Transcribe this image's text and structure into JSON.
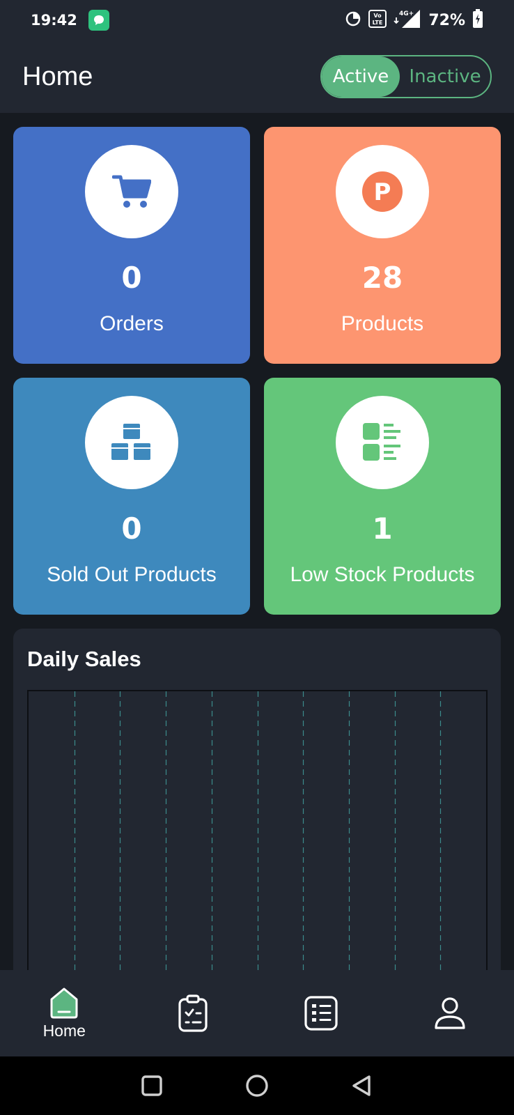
{
  "status_bar": {
    "time": "19:42",
    "network": "4G+",
    "volte": "Vo LTE",
    "battery": "72%"
  },
  "header": {
    "title": "Home",
    "toggle": {
      "active_label": "Active",
      "inactive_label": "Inactive",
      "selected": "Active"
    }
  },
  "cards": [
    {
      "value": "0",
      "label": "Orders",
      "icon": "cart-icon",
      "color": "#4470c6"
    },
    {
      "value": "28",
      "label": "Products",
      "icon": "product-p-icon",
      "color": "#fd9570"
    },
    {
      "value": "0",
      "label": "Sold Out Products",
      "icon": "boxes-icon",
      "color": "#3e89bd"
    },
    {
      "value": "1",
      "label": "Low Stock Products",
      "icon": "stock-list-icon",
      "color": "#64c67a"
    }
  ],
  "sales": {
    "title": "Daily Sales"
  },
  "chart_data": {
    "type": "bar",
    "title": "Daily Sales",
    "categories": [],
    "values": [],
    "grid": "vertical dashed",
    "legend": "none"
  },
  "bottom_nav": {
    "items": [
      {
        "label": "Home",
        "icon": "home-icon",
        "active": true
      },
      {
        "label": "",
        "icon": "clipboard-check-icon",
        "active": false
      },
      {
        "label": "",
        "icon": "list-icon",
        "active": false
      },
      {
        "label": "",
        "icon": "profile-icon",
        "active": false
      }
    ]
  },
  "colors": {
    "background": "#161a20",
    "surface": "#222731",
    "accent": "#5cb581",
    "grid": "#3c8c8c"
  }
}
